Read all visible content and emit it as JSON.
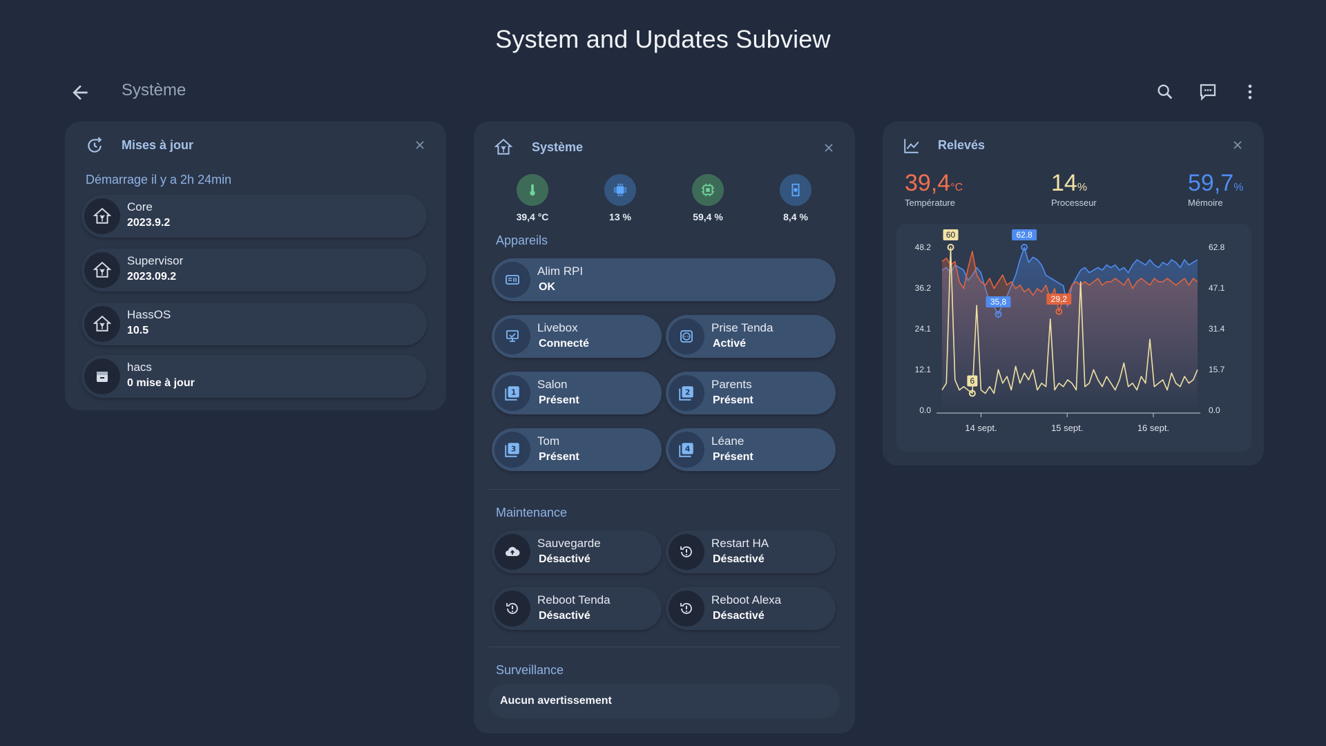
{
  "page_title": "System and Updates Subview",
  "topbar": {
    "title": "Système",
    "back_icon": "arrow-left-icon",
    "search_icon": "search-icon",
    "comment_icon": "comment-icon",
    "menu_icon": "more-vertical-icon"
  },
  "updates": {
    "title": "Mises à jour",
    "boot_text": "Démarrage il y a 2h 24min",
    "items": [
      {
        "name": "Core",
        "value": "2023.9.2",
        "icon": "home-assistant-icon"
      },
      {
        "name": "Supervisor",
        "value": "2023.09.2",
        "icon": "home-assistant-icon"
      },
      {
        "name": "HassOS",
        "value": "10.5",
        "icon": "home-assistant-icon"
      },
      {
        "name": "hacs",
        "value": "0 mise à jour",
        "icon": "package-icon"
      }
    ]
  },
  "system": {
    "title": "Système",
    "stats": [
      {
        "value": "39,4 °C",
        "icon": "thermometer-icon",
        "color": "#6fd49a"
      },
      {
        "value": "13 %",
        "icon": "cpu-icon",
        "color": "#5da8ff"
      },
      {
        "value": "59,4 %",
        "icon": "memory-icon",
        "color": "#6fd49a"
      },
      {
        "value": "8,4 %",
        "icon": "sd-card-icon",
        "color": "#5da8ff"
      }
    ],
    "devices_label": "Appareils",
    "devices": [
      {
        "name": "Alim RPI",
        "state": "OK",
        "icon": "power-supply-icon"
      },
      {
        "name": "Livebox",
        "state": "Connecté",
        "icon": "router-icon"
      },
      {
        "name": "Prise Tenda",
        "state": "Activé",
        "icon": "power-socket-icon"
      },
      {
        "name": "Salon",
        "state": "Présent",
        "icon": "numeric-1-box-icon",
        "num": "1"
      },
      {
        "name": "Parents",
        "state": "Présent",
        "icon": "numeric-2-box-icon",
        "num": "2"
      },
      {
        "name": "Tom",
        "state": "Présent",
        "icon": "numeric-3-box-icon",
        "num": "3"
      },
      {
        "name": "Léane",
        "state": "Présent",
        "icon": "numeric-4-box-icon",
        "num": "4"
      }
    ],
    "maintenance_label": "Maintenance",
    "maintenance": [
      {
        "name": "Sauvegarde",
        "state": "Désactivé",
        "icon": "cloud-upload-icon"
      },
      {
        "name": "Restart HA",
        "state": "Désactivé",
        "icon": "restart-alert-icon"
      },
      {
        "name": "Reboot Tenda",
        "state": "Désactivé",
        "icon": "restart-alert-icon"
      },
      {
        "name": "Reboot Alexa",
        "state": "Désactivé",
        "icon": "restart-alert-icon"
      }
    ],
    "surveillance_label": "Surveillance",
    "surveillance_text": "Aucun avertissement"
  },
  "readings": {
    "title": "Relevés",
    "temperature": {
      "value": "39,4",
      "unit": "°C",
      "label": "Température",
      "color": "#f0704f"
    },
    "processor": {
      "value": "14",
      "unit": "%",
      "label": "Processeur",
      "color": "#f1e3a6"
    },
    "memory": {
      "value": "59,7",
      "unit": "%",
      "label": "Mémoire",
      "color": "#4f8cf0"
    }
  },
  "chart_data": {
    "type": "line",
    "x_ticks": [
      "14 sept.",
      "15 sept.",
      "16 sept."
    ],
    "y_left_ticks": [
      "48.2",
      "36.2",
      "24.1",
      "12.1",
      "0.0"
    ],
    "y_right_ticks": [
      "62.8",
      "47.1",
      "31.4",
      "15.7",
      "0.0"
    ],
    "y_left_range": [
      0,
      48.2
    ],
    "y_right_range": [
      0,
      62.8
    ],
    "series": [
      {
        "color": "#4f8cf0",
        "axis": "right",
        "values": [
          54,
          55,
          53,
          56,
          55,
          54,
          50,
          52,
          55,
          53,
          47,
          42,
          40,
          37,
          41,
          44,
          48,
          52,
          58,
          62.8,
          57,
          59,
          58,
          56,
          52,
          51,
          50,
          49,
          48,
          40,
          48,
          51,
          54,
          55,
          53,
          54,
          55,
          54,
          56,
          55,
          56,
          54,
          55,
          53,
          56,
          58,
          57,
          56,
          58,
          56,
          55,
          57,
          56,
          58,
          57,
          55,
          58,
          56,
          57,
          58
        ],
        "annotations": [
          {
            "value": "62.8"
          },
          {
            "value": "35,8"
          }
        ]
      },
      {
        "color": "#e0653f",
        "axis": "left",
        "values": [
          44,
          45,
          43,
          44,
          38,
          36,
          42,
          47,
          40,
          38,
          37,
          39,
          36,
          38,
          40,
          37,
          38,
          36,
          37,
          35,
          36,
          34,
          36,
          35,
          37,
          33,
          36,
          29.2,
          33,
          34,
          37,
          38,
          37,
          38,
          37,
          38,
          39,
          37,
          38,
          38,
          39,
          38,
          37,
          39,
          36,
          38,
          39,
          38,
          37,
          39,
          38,
          38,
          39,
          38,
          37,
          38,
          39,
          37,
          39,
          38
        ],
        "annotations": [
          {
            "value": "60"
          },
          {
            "value": "29,2"
          }
        ]
      },
      {
        "color": "#efe2a4",
        "axis": "left",
        "values": [
          6,
          8,
          48.2,
          9,
          6,
          7,
          6,
          5,
          31,
          6,
          5,
          7,
          5,
          12,
          8,
          10,
          6,
          13,
          8,
          11,
          9,
          12,
          6,
          8,
          7,
          27,
          6,
          8,
          7,
          9,
          8,
          6,
          38,
          7,
          8,
          12,
          9,
          7,
          10,
          8,
          6,
          9,
          14,
          7,
          8,
          6,
          10,
          8,
          21,
          7,
          8,
          9,
          6,
          11,
          8,
          7,
          10,
          8,
          9,
          12
        ],
        "annotations": [
          {
            "value": "6"
          }
        ]
      }
    ]
  }
}
